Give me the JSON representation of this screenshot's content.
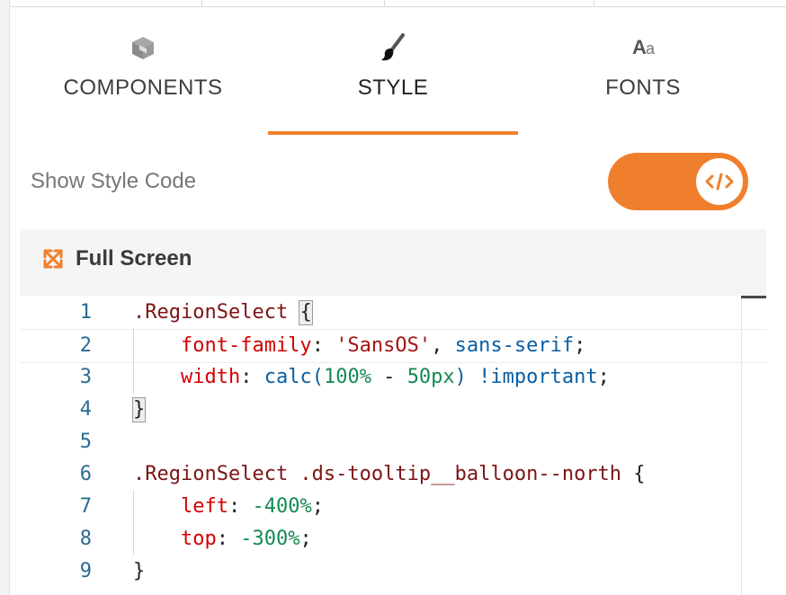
{
  "tabs": [
    {
      "label": "COMPONENTS",
      "icon": "cube-icon",
      "active": false
    },
    {
      "label": "STYLE",
      "icon": "paintbrush-icon",
      "active": true
    },
    {
      "label": "FONTS",
      "icon": "font-icon",
      "active": false
    }
  ],
  "fonts_icon": {
    "big": "A",
    "small": "a"
  },
  "style_toggle": {
    "label": "Show Style Code",
    "on": true,
    "knob_icon": "code-icon"
  },
  "fullscreen": {
    "label": "Full Screen",
    "icon": "expand-arrows-icon"
  },
  "colors": {
    "accent": "#f07f2d"
  },
  "editor": {
    "lines": [
      {
        "num": "1",
        "tokens": [
          {
            "t": ".RegionSelect ",
            "c": "sel"
          },
          {
            "t": "{",
            "c": "brace"
          }
        ]
      },
      {
        "num": "2",
        "tokens": [
          {
            "t": "    font-family",
            "c": "prop"
          },
          {
            "t": ": ",
            "c": "punc"
          },
          {
            "t": "'SansOS'",
            "c": "str"
          },
          {
            "t": ", ",
            "c": "punc"
          },
          {
            "t": "sans-serif",
            "c": "val"
          },
          {
            "t": ";",
            "c": "punc"
          }
        ]
      },
      {
        "num": "3",
        "tokens": [
          {
            "t": "    width",
            "c": "prop"
          },
          {
            "t": ": ",
            "c": "punc"
          },
          {
            "t": "calc(",
            "c": "val"
          },
          {
            "t": "100%",
            "c": "num"
          },
          {
            "t": " - ",
            "c": "punc"
          },
          {
            "t": "50px",
            "c": "num"
          },
          {
            "t": ") !important",
            "c": "val"
          },
          {
            "t": ";",
            "c": "punc"
          }
        ]
      },
      {
        "num": "4",
        "tokens": [
          {
            "t": "}",
            "c": "brace"
          }
        ]
      },
      {
        "num": "5",
        "tokens": []
      },
      {
        "num": "6",
        "tokens": [
          {
            "t": ".RegionSelect .ds-tooltip__balloon--north ",
            "c": "sel"
          },
          {
            "t": "{",
            "c": "punc"
          }
        ]
      },
      {
        "num": "7",
        "tokens": [
          {
            "t": "    left",
            "c": "prop"
          },
          {
            "t": ": ",
            "c": "punc"
          },
          {
            "t": "-400%",
            "c": "num"
          },
          {
            "t": ";",
            "c": "punc"
          }
        ]
      },
      {
        "num": "8",
        "tokens": [
          {
            "t": "    top",
            "c": "prop"
          },
          {
            "t": ": ",
            "c": "punc"
          },
          {
            "t": "-300%",
            "c": "num"
          },
          {
            "t": ";",
            "c": "punc"
          }
        ]
      },
      {
        "num": "9",
        "tokens": [
          {
            "t": "}",
            "c": "punc"
          }
        ]
      }
    ]
  }
}
